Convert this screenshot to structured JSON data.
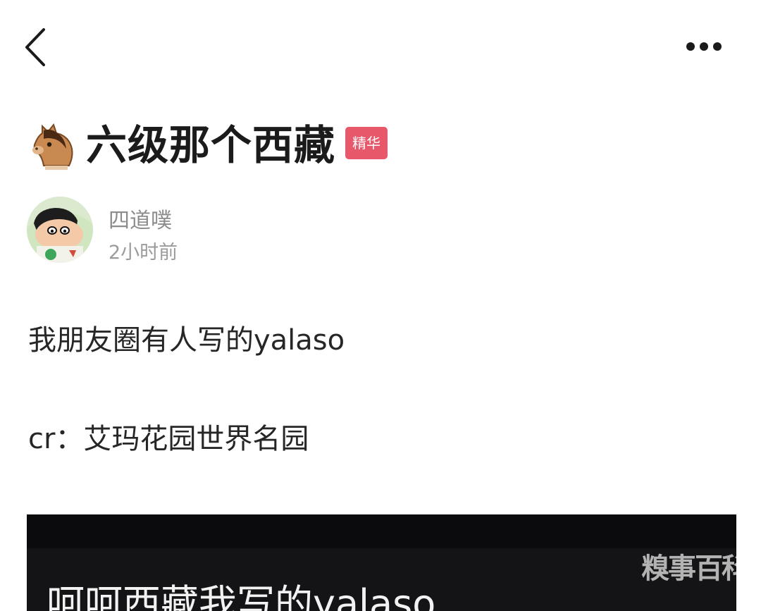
{
  "header": {
    "back_icon": "chevron-left-icon",
    "more_icon": "more-horizontal-icon"
  },
  "post": {
    "title_emoji": "horse-face-emoji",
    "title": "六级那个西藏",
    "badge": "精华",
    "badge_color": "#e8586b",
    "author": {
      "name": "四道噗",
      "time": "2小时前",
      "avatar": "cartoon-boy-avatar"
    },
    "body": {
      "line1": "我朋友圈有人写的yalaso",
      "line2": "cr：艾玛花园世界名园"
    },
    "embed": {
      "caption": "呵呵西藏我写的yalaso",
      "watermark": "糗事百科"
    }
  }
}
